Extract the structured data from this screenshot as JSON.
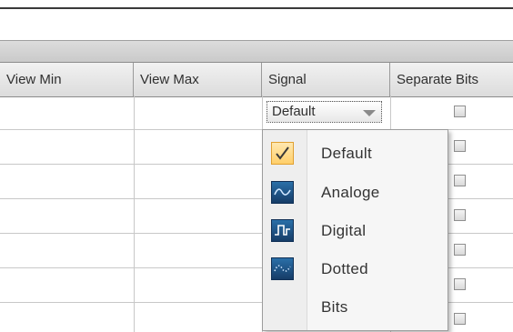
{
  "columns": [
    "View Min",
    "View Max",
    "Signal",
    "Separate Bits"
  ],
  "signal_combo": {
    "value": "Default"
  },
  "signal_menu": {
    "items": [
      {
        "label": "Default",
        "icon": "check-icon",
        "selected": true
      },
      {
        "label": "Analoge",
        "icon": "analog-wave-icon",
        "selected": false
      },
      {
        "label": "Digital",
        "icon": "digital-pulse-icon",
        "selected": false
      },
      {
        "label": "Dotted",
        "icon": "dotted-wave-icon",
        "selected": false
      },
      {
        "label": "Bits",
        "icon": "",
        "selected": false
      }
    ]
  },
  "separate_bits_checked": [
    false,
    false,
    false,
    false,
    false,
    false,
    false
  ]
}
